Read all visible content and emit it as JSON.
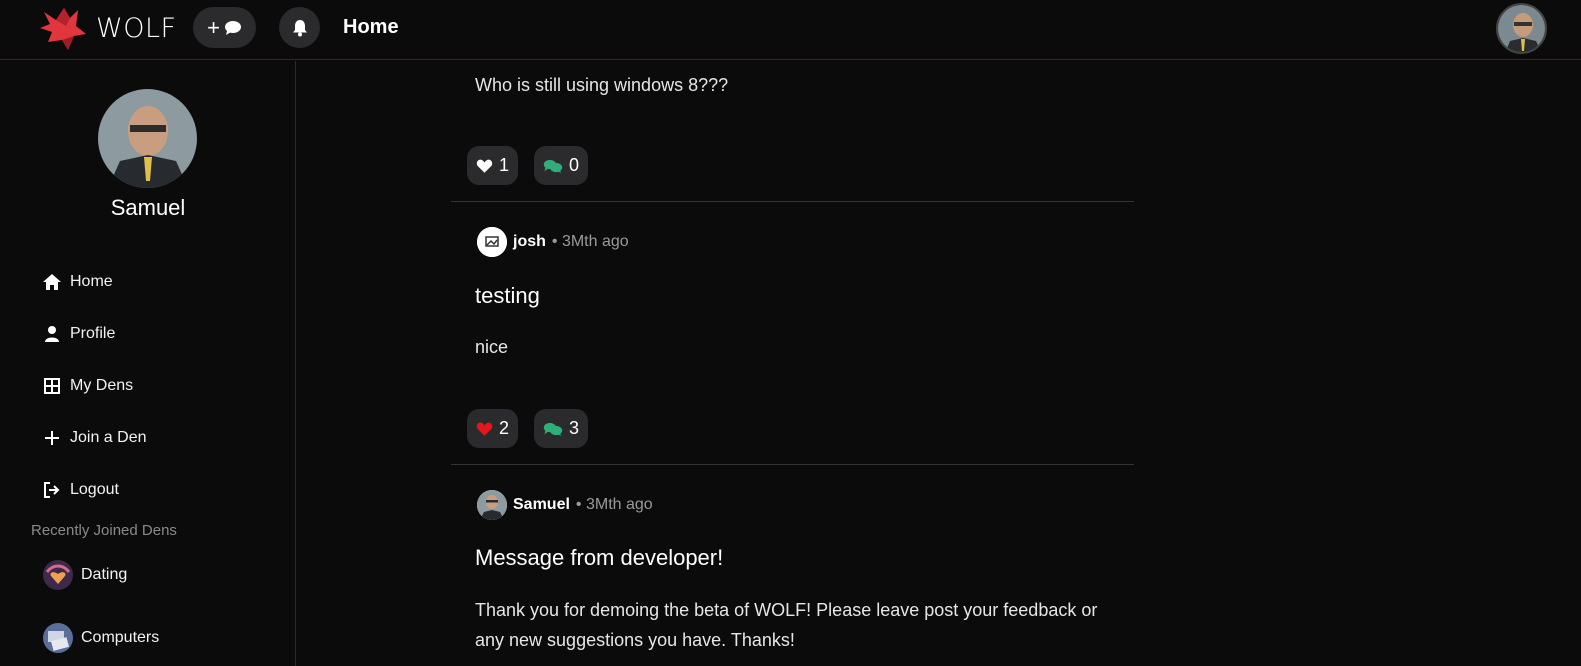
{
  "app": {
    "logo_text": "WOLF",
    "page_title": "Home"
  },
  "colors": {
    "accent": "#e0363c",
    "comment": "#2fae79",
    "border": "#5a1226"
  },
  "header": {
    "new_post_icon": "plus-chat-icon",
    "bell_icon": "bell-icon"
  },
  "sidebar": {
    "user_name": "Samuel",
    "nav": [
      {
        "label": "Home",
        "icon": "home-icon"
      },
      {
        "label": "Profile",
        "icon": "user-icon"
      },
      {
        "label": "My Dens",
        "icon": "grid-icon"
      },
      {
        "label": "Join a Den",
        "icon": "plus-icon"
      },
      {
        "label": "Logout",
        "icon": "logout-icon"
      }
    ],
    "recent_title": "Recently Joined Dens",
    "dens": [
      {
        "label": "Dating"
      },
      {
        "label": "Computers"
      }
    ]
  },
  "posts": [
    {
      "body": "Who is still using windows 8???",
      "likes": "1",
      "comments": "0",
      "liked": false
    },
    {
      "author": "josh",
      "time": "• 3Mth ago",
      "title": "testing",
      "body": "nice",
      "likes": "2",
      "comments": "3",
      "liked": true
    },
    {
      "author": "Samuel",
      "time": "• 3Mth ago",
      "title": "Message from developer!",
      "body": "Thank you for demoing the beta of WOLF! Please leave post your feedback or any new suggestions you have. Thanks!"
    }
  ]
}
